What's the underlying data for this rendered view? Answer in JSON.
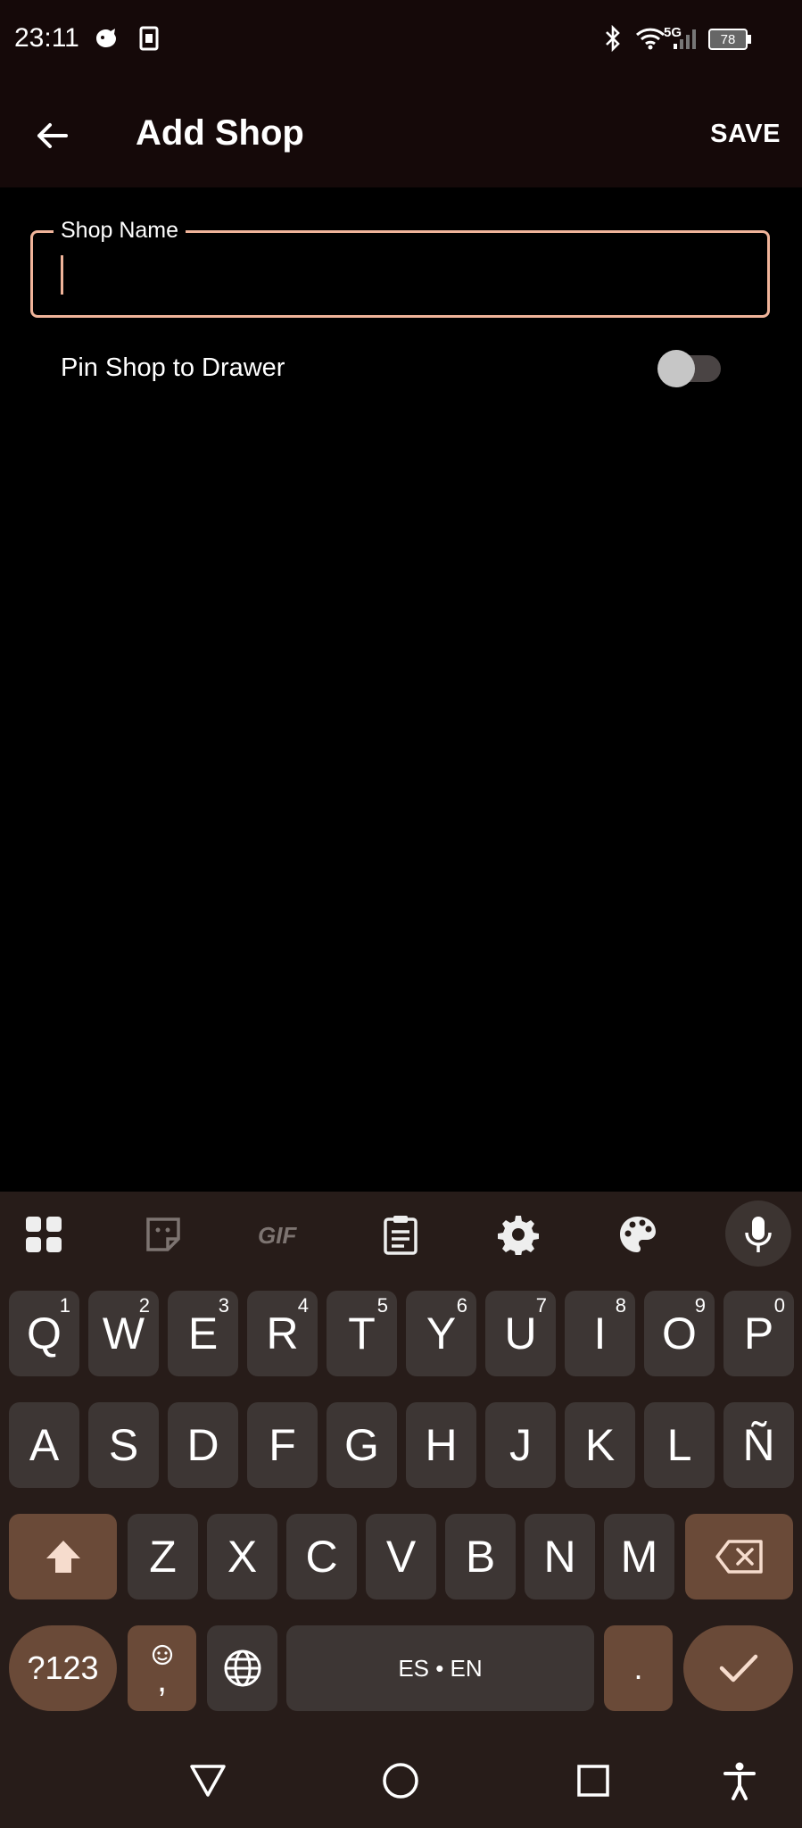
{
  "status": {
    "time": "23:11",
    "network": "5G",
    "battery": "78"
  },
  "appbar": {
    "title": "Add Shop",
    "save_label": "SAVE"
  },
  "form": {
    "shop_name_label": "Shop Name",
    "shop_name_value": "",
    "pin_label": "Pin Shop to Drawer",
    "pin_enabled": false
  },
  "keyboard": {
    "row1": [
      {
        "label": "Q",
        "hint": "1"
      },
      {
        "label": "W",
        "hint": "2"
      },
      {
        "label": "E",
        "hint": "3"
      },
      {
        "label": "R",
        "hint": "4"
      },
      {
        "label": "T",
        "hint": "5"
      },
      {
        "label": "Y",
        "hint": "6"
      },
      {
        "label": "U",
        "hint": "7"
      },
      {
        "label": "I",
        "hint": "8"
      },
      {
        "label": "O",
        "hint": "9"
      },
      {
        "label": "P",
        "hint": "0"
      }
    ],
    "row2": [
      "A",
      "S",
      "D",
      "F",
      "G",
      "H",
      "J",
      "K",
      "L",
      "Ñ"
    ],
    "row3": [
      "Z",
      "X",
      "C",
      "V",
      "B",
      "N",
      "M"
    ],
    "symbols_label": "?123",
    "comma_label": ",",
    "space_label": "ES • EN",
    "period_label": "."
  },
  "colors": {
    "accent": "#f0b49a",
    "bar_bg": "#150909",
    "keyboard_bg": "#271c19",
    "key_bg": "#3d3634",
    "func_key_bg": "#6a4a38"
  }
}
